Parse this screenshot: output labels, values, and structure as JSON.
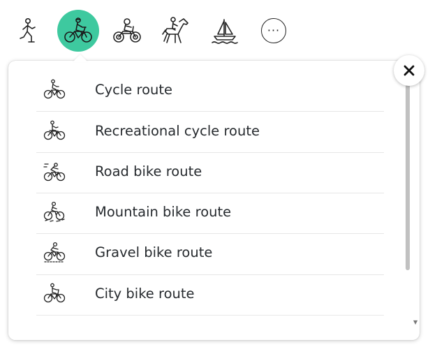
{
  "modes": [
    {
      "icon": "walking-icon",
      "active": false
    },
    {
      "icon": "bicycle-icon",
      "active": true
    },
    {
      "icon": "motorcycle-icon",
      "active": false
    },
    {
      "icon": "horse-riding-icon",
      "active": false
    },
    {
      "icon": "sailboat-icon",
      "active": false
    },
    {
      "icon": "more-icon",
      "label": "···",
      "active": false
    }
  ],
  "accent_color": "#3ec99f",
  "menu": {
    "items": [
      {
        "label": "Cycle route",
        "icon": "cyclist-icon"
      },
      {
        "label": "Recreational cycle route",
        "icon": "recreational-cyclist-icon"
      },
      {
        "label": "Road bike route",
        "icon": "road-bike-icon"
      },
      {
        "label": "Mountain bike route",
        "icon": "mountain-bike-icon"
      },
      {
        "label": "Gravel bike route",
        "icon": "gravel-bike-icon"
      },
      {
        "label": "City bike route",
        "icon": "city-bike-icon"
      }
    ],
    "close_icon": "close-icon"
  }
}
